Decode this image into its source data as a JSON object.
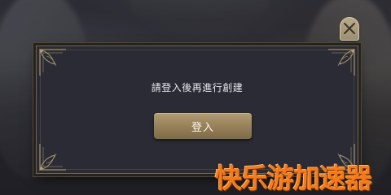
{
  "dialog": {
    "message": "請登入後再進行創建",
    "login_label": "登入"
  },
  "watermark": {
    "text": "快乐游加速器",
    "color": "#f47a1a"
  },
  "colors": {
    "dialog_bg": "#2b2b36",
    "frame_gold": "#6e6450",
    "button_gold": "#957f58",
    "close_button": "#b9ab8a"
  },
  "icons": {
    "close": "close-icon",
    "corner_ornament": "corner-ornament-icon"
  }
}
